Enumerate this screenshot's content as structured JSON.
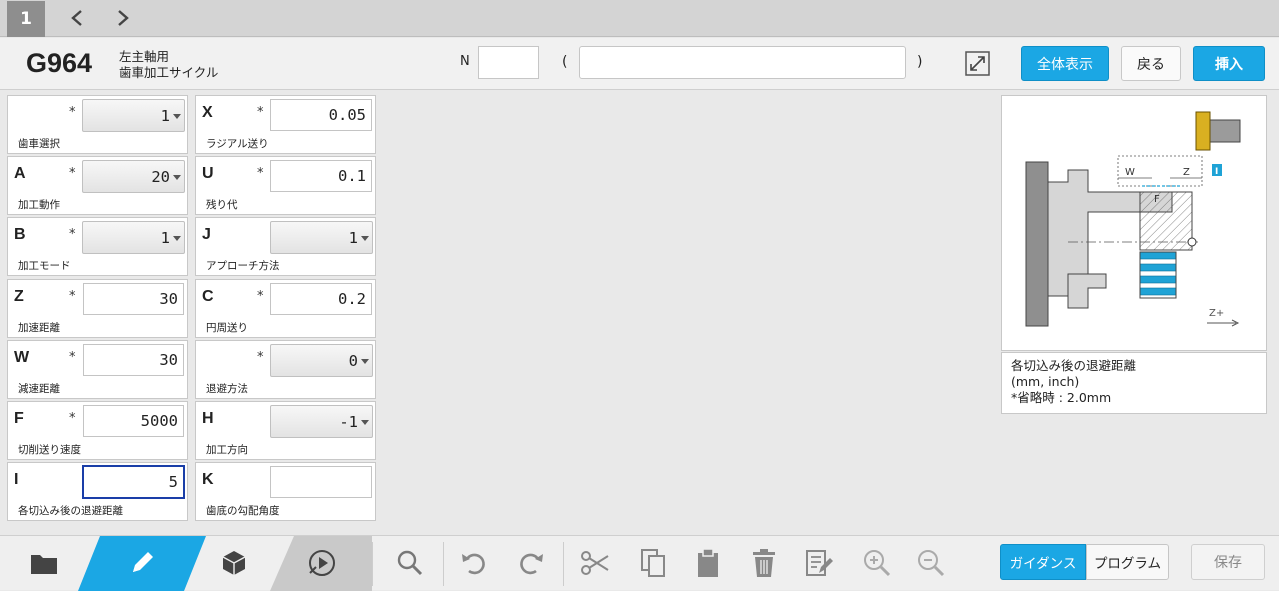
{
  "tab": {
    "number": "1"
  },
  "header": {
    "gcode": "G964",
    "desc_line1": "左主軸用",
    "desc_line2": "歯車加工サイクル",
    "n_label": "N",
    "n_value": "",
    "paren_open": "(",
    "paren_close": ")",
    "comment_value": "",
    "buttons": {
      "show_all": "全体表示",
      "back": "戻る",
      "insert": "挿入"
    }
  },
  "params_left": [
    {
      "letter": "",
      "required": "*",
      "value": "1",
      "type": "select",
      "caption": "歯車選択"
    },
    {
      "letter": "A",
      "required": "*",
      "value": "20",
      "type": "select",
      "caption": "加工動作"
    },
    {
      "letter": "B",
      "required": "*",
      "value": "1",
      "type": "select",
      "caption": "加工モード"
    },
    {
      "letter": "Z",
      "required": "*",
      "value": "30",
      "type": "input",
      "caption": "加速距離"
    },
    {
      "letter": "W",
      "required": "*",
      "value": "30",
      "type": "input",
      "caption": "減速距離"
    },
    {
      "letter": "F",
      "required": "*",
      "value": "5000",
      "type": "input",
      "caption": "切削送り速度"
    },
    {
      "letter": "I",
      "required": "",
      "value": "5",
      "type": "input",
      "caption": "各切込み後の退避距離"
    }
  ],
  "params_right": [
    {
      "letter": "X",
      "required": "*",
      "value": "0.05",
      "type": "input",
      "caption": "ラジアル送り"
    },
    {
      "letter": "U",
      "required": "*",
      "value": "0.1",
      "type": "input",
      "caption": "残り代"
    },
    {
      "letter": "J",
      "required": "",
      "value": "1",
      "type": "select",
      "caption": "アプローチ方法"
    },
    {
      "letter": "C",
      "required": "*",
      "value": "0.2",
      "type": "input",
      "caption": "円周送り"
    },
    {
      "letter": "",
      "required": "*",
      "value": "0",
      "type": "select",
      "caption": "退避方法"
    },
    {
      "letter": "H",
      "required": "",
      "value": "-1",
      "type": "select",
      "caption": "加工方向"
    },
    {
      "letter": "K",
      "required": "",
      "value": "",
      "type": "input",
      "caption": "歯底の勾配角度"
    }
  ],
  "diagram": {
    "label_w": "W",
    "label_z": "Z",
    "label_f": "F",
    "label_i": "I",
    "label_axis": "Z+"
  },
  "guide": {
    "line1": "各切込み後の退避距離",
    "line2": "(mm, inch)",
    "line3": "*省略時 : 2.0mm"
  },
  "bottom": {
    "tab_guidance": "ガイダンス",
    "tab_program": "プログラム",
    "save": "保存"
  },
  "colors": {
    "accent": "#1ba7e4",
    "active_border": "#1a3ea8"
  }
}
